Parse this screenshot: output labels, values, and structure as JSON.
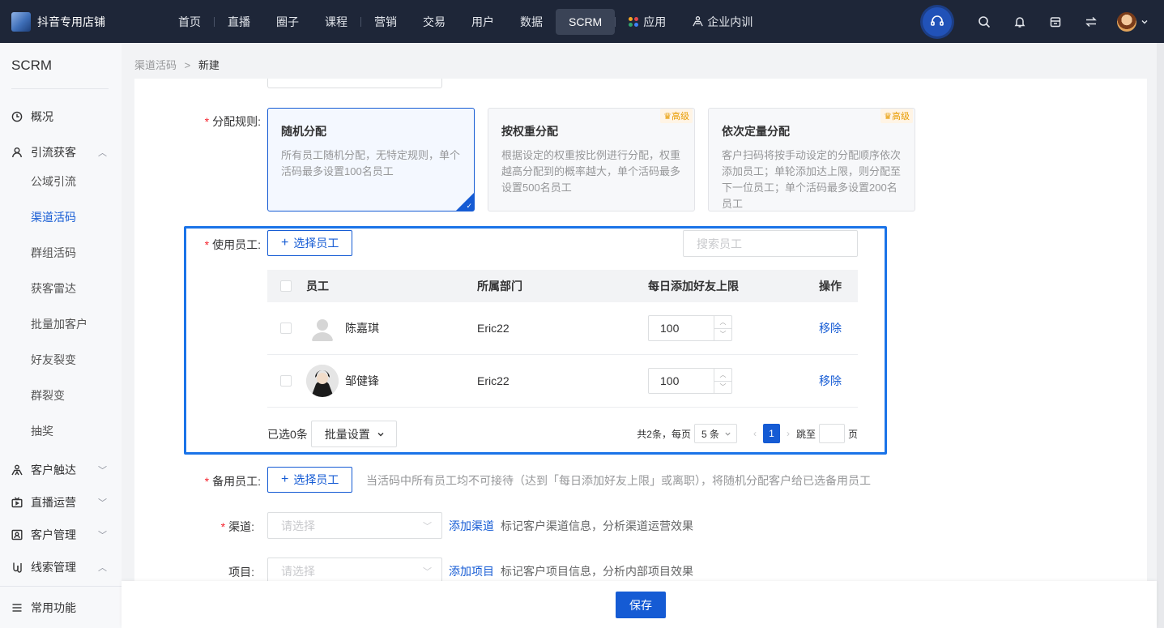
{
  "brand": {
    "name": "抖音专用店铺"
  },
  "nav": {
    "items": [
      "首页",
      "直播",
      "圈子",
      "课程",
      "营销",
      "交易",
      "用户",
      "数据",
      "SCRM",
      "应用",
      "企业内训"
    ],
    "active": "SCRM"
  },
  "sidebar": {
    "title": "SCRM",
    "overview": "概况",
    "group_lead": "引流获客",
    "sub_items": [
      "公域引流",
      "渠道活码",
      "群组活码",
      "获客雷达",
      "批量加客户",
      "好友裂变",
      "群裂变",
      "抽奖"
    ],
    "active_sub": "渠道活码",
    "group_reach": "客户触达",
    "group_live": "直播运营",
    "group_customer": "客户管理",
    "group_clue": "线索管理",
    "bottom": "常用功能"
  },
  "breadcrumb": {
    "parent": "渠道活码",
    "separator": ">",
    "current": "新建"
  },
  "form": {
    "rule_label": "分配规则:",
    "rules": [
      {
        "title": "随机分配",
        "desc": "所有员工随机分配，无特定规则，单个活码最多设置100名员工",
        "badge": ""
      },
      {
        "title": "按权重分配",
        "desc": "根据设定的权重按比例进行分配，权重越高分配到的概率越大，单个活码最多设置500名员工",
        "badge": "高级"
      },
      {
        "title": "依次定量分配",
        "desc": "客户扫码将按手动设定的分配顺序依次添加员工；单轮添加达上限，则分配至下一位员工；单个活码最多设置200名员工",
        "badge": "高级"
      }
    ],
    "staff_label": "使用员工:",
    "select_staff_btn": "选择员工",
    "search_placeholder": "搜索员工",
    "table": {
      "headers": [
        "员工",
        "所属部门",
        "每日添加好友上限",
        "操作"
      ],
      "rows": [
        {
          "name": "陈嘉琪",
          "dept": "Eric22",
          "limit": "100",
          "action": "移除"
        },
        {
          "name": "邹健锋",
          "dept": "Eric22",
          "limit": "100",
          "action": "移除"
        }
      ]
    },
    "selected_count": "已选0条",
    "batch_btn": "批量设置",
    "pager": {
      "total": "共2条，每页",
      "page_size": "5 条",
      "current": "1",
      "jump": "跳至",
      "page_unit": "页"
    },
    "backup_label": "备用员工:",
    "backup_btn": "选择员工",
    "backup_hint": "当活码中所有员工均不可接待（达到「每日添加好友上限」或离职），将随机分配客户给已选备用员工",
    "channel_label": "渠道:",
    "channel_placeholder": "请选择",
    "channel_link": "添加渠道",
    "channel_hint": "标记客户渠道信息，分析渠道运营效果",
    "project_label": "项目:",
    "project_placeholder": "请选择",
    "project_link": "添加项目",
    "project_hint": "标记客户项目信息，分析内部项目效果"
  },
  "save_label": "保存",
  "colors": {
    "primary": "#155bd4",
    "topbar": "#1e2638",
    "highlight": "#1a73e8",
    "required": "#f5222d",
    "badge": "#e89b00"
  }
}
